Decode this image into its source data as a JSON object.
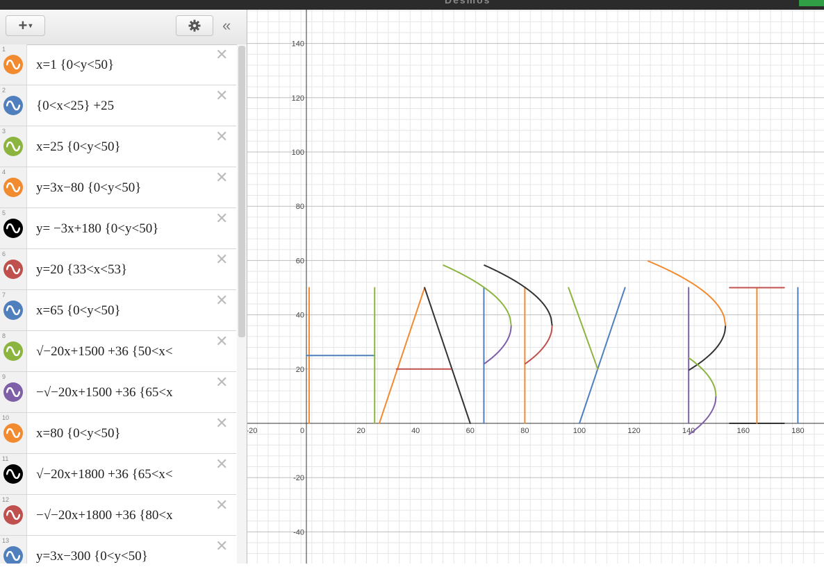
{
  "window": {
    "title": "Desmos"
  },
  "toolbar": {
    "add_label": "+",
    "add_caret": "▾",
    "collapse_label": "«"
  },
  "expressions": [
    {
      "num": "1",
      "color": "#f28b30",
      "text": "x=1 {0<y<50}"
    },
    {
      "num": "2",
      "color": "#4f80bd",
      "text": "{0<x<25} +25"
    },
    {
      "num": "3",
      "color": "#8cb53f",
      "text": "x=25 {0<y<50}"
    },
    {
      "num": "4",
      "color": "#f28b30",
      "text": "y=3x−80 {0<y<50}"
    },
    {
      "num": "5",
      "color": "#000000",
      "text": "y= −3x+180 {0<y<50}"
    },
    {
      "num": "6",
      "color": "#c0504d",
      "text": "y=20 {33<x<53}"
    },
    {
      "num": "7",
      "color": "#4f80bd",
      "text": "x=65 {0<y<50}"
    },
    {
      "num": "8",
      "color": "#8cb53f",
      "text": "√−20x+1500 +36 {50<x<"
    },
    {
      "num": "9",
      "color": "#7f5fa8",
      "text": "−√−20x+1500 +36 {65<x"
    },
    {
      "num": "10",
      "color": "#f28b30",
      "text": "x=80 {0<y<50}"
    },
    {
      "num": "11",
      "color": "#000000",
      "text": "√−20x+1800 +36 {65<x<"
    },
    {
      "num": "12",
      "color": "#c0504d",
      "text": "−√−20x+1800 +36 {80<x"
    },
    {
      "num": "13",
      "color": "#4f80bd",
      "text": "y=3x−300 {0<y<50}"
    }
  ],
  "delete_label": "✕",
  "graph": {
    "x_ticks": [
      "-20",
      "0",
      "20",
      "40",
      "60",
      "80",
      "100",
      "120",
      "140",
      "160",
      "180"
    ],
    "y_ticks": [
      "140",
      "120",
      "100",
      "80",
      "60",
      "40",
      "20",
      "-20",
      "-40"
    ]
  }
}
